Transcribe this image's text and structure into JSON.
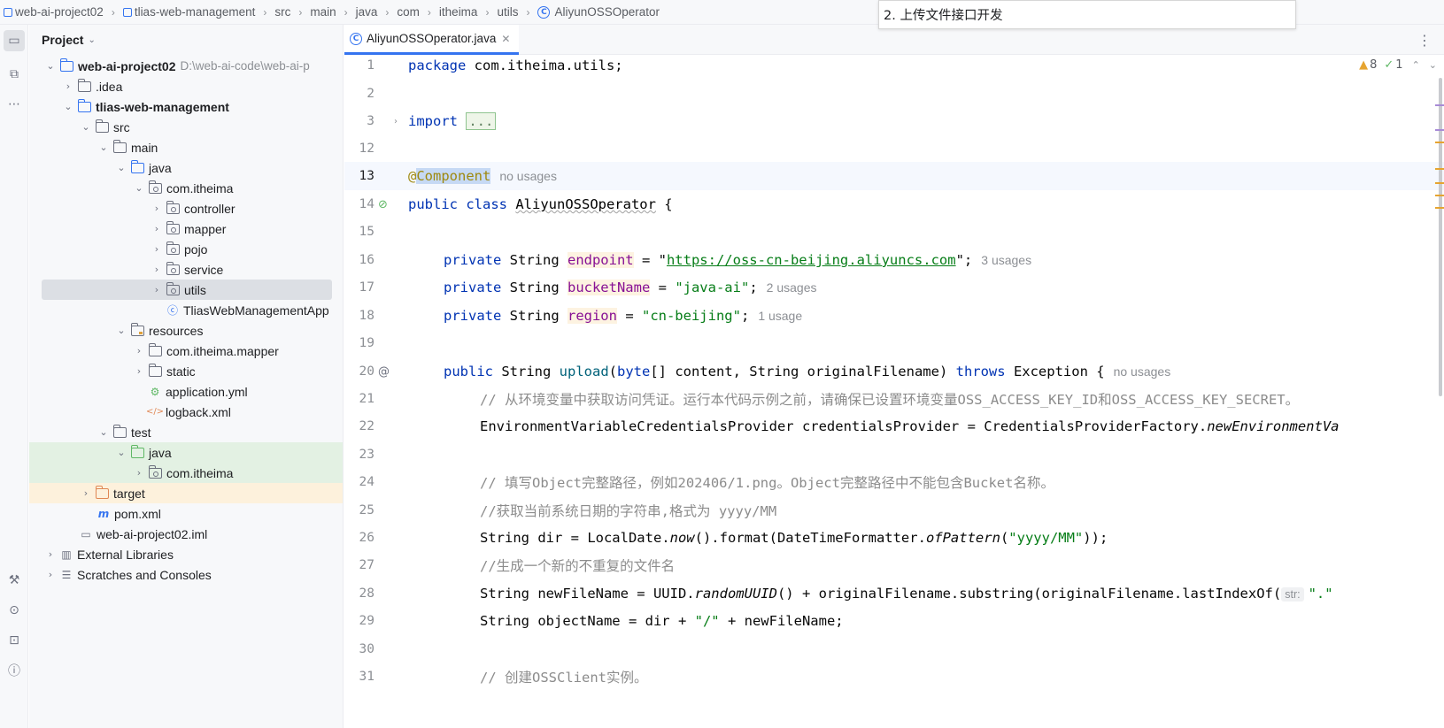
{
  "breadcrumb": [
    "web-ai-project02",
    "tlias-web-management",
    "src",
    "main",
    "java",
    "com",
    "itheima",
    "utils",
    "AliyunOSSOperator"
  ],
  "overlay_note": "2. 上传文件接口开发",
  "tool_strip": {
    "icons": [
      "folder-icon",
      "structure-icon",
      "more-icon",
      "build-icon",
      "services-icon",
      "terminal-icon",
      "problems-icon"
    ]
  },
  "project_panel": {
    "title": "Project",
    "tree": [
      {
        "label": "web-ai-project02",
        "path": "D:\\web-ai-code\\web-ai-p",
        "bold": true
      },
      {
        "label": ".idea"
      },
      {
        "label": "tlias-web-management",
        "bold": true
      },
      {
        "label": "src"
      },
      {
        "label": "main"
      },
      {
        "label": "java"
      },
      {
        "label": "com.itheima"
      },
      {
        "label": "controller"
      },
      {
        "label": "mapper"
      },
      {
        "label": "pojo"
      },
      {
        "label": "service"
      },
      {
        "label": "utils"
      },
      {
        "label": "TliasWebManagementApp"
      },
      {
        "label": "resources"
      },
      {
        "label": "com.itheima.mapper"
      },
      {
        "label": "static"
      },
      {
        "label": "application.yml"
      },
      {
        "label": "logback.xml"
      },
      {
        "label": "test"
      },
      {
        "label": "java"
      },
      {
        "label": "com.itheima"
      },
      {
        "label": "target"
      },
      {
        "label": "pom.xml"
      },
      {
        "label": "web-ai-project02.iml"
      },
      {
        "label": "External Libraries"
      },
      {
        "label": "Scratches and Consoles"
      }
    ]
  },
  "editor": {
    "tab_label": "AliyunOSSOperator.java",
    "inspections": {
      "warnings": "8",
      "ok": "1"
    },
    "line_numbers": [
      "1",
      "2",
      "3",
      "12",
      "13",
      "14",
      "15",
      "16",
      "17",
      "18",
      "19",
      "20",
      "21",
      "22",
      "23",
      "24",
      "25",
      "26",
      "27",
      "28",
      "29",
      "30",
      "31"
    ],
    "code": {
      "l1_kw": "package",
      "l1_rest": " com.itheima.utils;",
      "l3_kw": "import",
      "l3_fold": "...",
      "l13_at": "@",
      "l13_ann": "Component",
      "l13_hint": "no usages",
      "l14_kw": "public class",
      "l14_cls": "AliyunOSSOperator",
      "l14_rest": " {",
      "l16_pre": "private String ",
      "l16_field": "endpoint",
      "l16_eq": " = \"",
      "l16_url": "https://oss-cn-beijing.aliyuncs.com",
      "l16_end": "\";",
      "l16_hint": "3 usages",
      "l17_pre": "private String ",
      "l17_field": "bucketName",
      "l17_eq": " = ",
      "l17_str": "\"java-ai\"",
      "l17_end": ";",
      "l17_hint": "2 usages",
      "l18_pre": "private String ",
      "l18_field": "region",
      "l18_eq": " = ",
      "l18_str": "\"cn-beijing\"",
      "l18_end": ";",
      "l18_hint": "1 usage",
      "l20_kw": "public",
      "l20_type": " String ",
      "l20_name": "upload",
      "l20_p1": "(",
      "l20_byte": "byte",
      "l20_p2": "[] content, String originalFilename) ",
      "l20_throws": "throws",
      "l20_p3": " Exception {",
      "l20_hint": "no usages",
      "l21": "// 从环境变量中获取访问凭证。运行本代码示例之前，请确保已设置环境变量OSS_ACCESS_KEY_ID和OSS_ACCESS_KEY_SECRET。",
      "l22_a": "EnvironmentVariableCredentialsProvider credentialsProvider = CredentialsProviderFactory.",
      "l22_b": "newEnvironmentVa",
      "l24": "// 填写Object完整路径，例如202406/1.png。Object完整路径中不能包含Bucket名称。",
      "l25": "//获取当前系统日期的字符串,格式为 yyyy/MM",
      "l26_a": "String dir = LocalDate.",
      "l26_now": "now",
      "l26_b": "().format(DateTimeFormatter.",
      "l26_of": "ofPattern",
      "l26_c": "(",
      "l26_str": "\"yyyy/MM\"",
      "l26_d": "));",
      "l27": "//生成一个新的不重复的文件名",
      "l28_a": "String newFileName = UUID.",
      "l28_uuid": "randomUUID",
      "l28_b": "() + originalFilename.substring(originalFilename.lastIndexOf(",
      "l28_hint": "str:",
      "l28_str": "\".\"",
      "l29_a": "String objectName = dir + ",
      "l29_str": "\"/\"",
      "l29_b": " + newFileName;",
      "l31": "// 创建OSSClient实例。"
    }
  }
}
